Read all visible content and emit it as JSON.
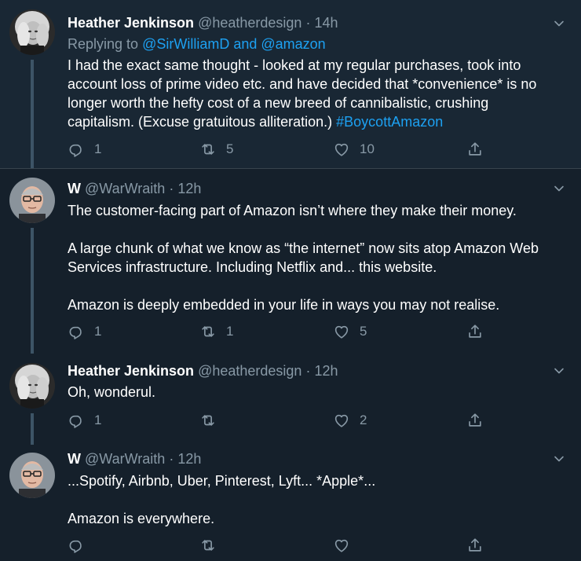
{
  "tweets": [
    {
      "name": "Heather Jenkinson",
      "handle": "@heatherdesign",
      "time": "14h",
      "replying_prefix": "Replying to",
      "replying_to": "@SirWilliamD and @amazon",
      "text": [
        "I had the exact same thought - looked at my regular purchases, took into",
        "account loss of prime video etc. and have decided that *convenience*  is no",
        "longer worth the hefty cost of a new breed of cannibalistic, crushing",
        "capitalism. (Excuse gratuitous alliteration.)"
      ],
      "hashtag": "#BoycottAmazon",
      "replies": "1",
      "retweets": "5",
      "likes": "10"
    },
    {
      "name": "W",
      "handle": "@WarWraith",
      "time": "12h",
      "text": [
        "The customer-facing part of Amazon isn’t where they make their money.",
        "A large chunk of what we know as “the internet” now sits atop Amazon Web",
        "Services infrastructure. Including Netflix and... this website.",
        "Amazon is deeply embedded in your life in ways you may not realise."
      ],
      "replies": "1",
      "retweets": "1",
      "likes": "5"
    },
    {
      "name": "Heather Jenkinson",
      "handle": "@heatherdesign",
      "time": "12h",
      "text": [
        "Oh, wonderul."
      ],
      "replies": "1",
      "retweets": "",
      "likes": "2"
    },
    {
      "name": "W",
      "handle": "@WarWraith",
      "time": "12h",
      "text": [
        "...Spotify, Airbnb, Uber, Pinterest, Lyft... *Apple*...",
        "Amazon is everywhere."
      ],
      "replies": "",
      "retweets": "",
      "likes": ""
    }
  ],
  "separator": "·",
  "icons": {
    "reply": "reply-icon",
    "retweet": "retweet-icon",
    "like": "like-icon",
    "share": "share-icon",
    "more": "chevron-down-icon"
  },
  "colors": {
    "background": "#15202b",
    "highlight": "#192734",
    "link": "#1da1f2",
    "muted": "#8899a6"
  }
}
